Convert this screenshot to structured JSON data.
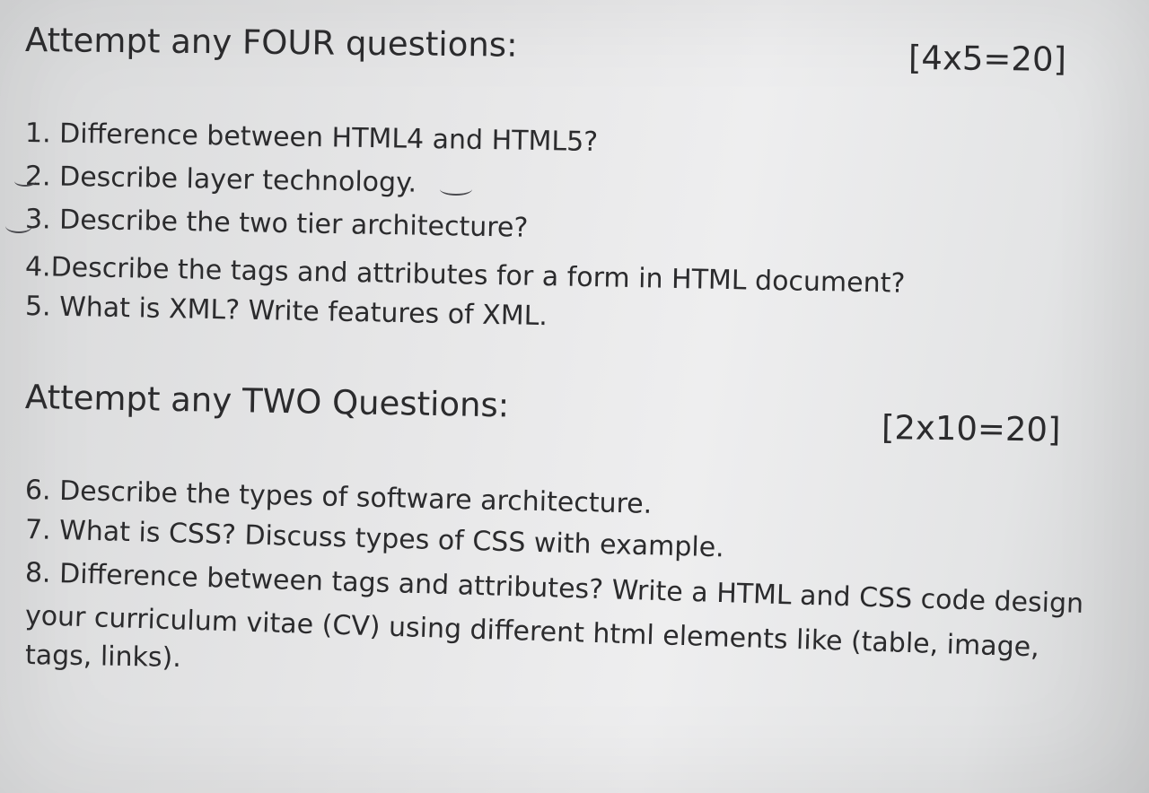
{
  "section_a": {
    "heading": "Attempt any FOUR questions:",
    "marks": "[4x5=20]",
    "questions": [
      "1. Difference between HTML4 and HTML5?",
      "2. Describe layer technology.",
      "3. Describe the two tier architecture?",
      "4.Describe the tags and attributes for a form in HTML document?",
      "5. What is XML? Write features of XML."
    ]
  },
  "section_b": {
    "heading": "Attempt any TWO Questions:",
    "marks": "[2x10=20]",
    "questions": [
      "6. Describe the types of software architecture.",
      "7. What is CSS? Discuss types of CSS with example.",
      "8. Difference between tags and attributes? Write a HTML and CSS code design",
      "your curriculum vitae (CV) using different html elements like (table, image,",
      "tags, links)."
    ]
  }
}
